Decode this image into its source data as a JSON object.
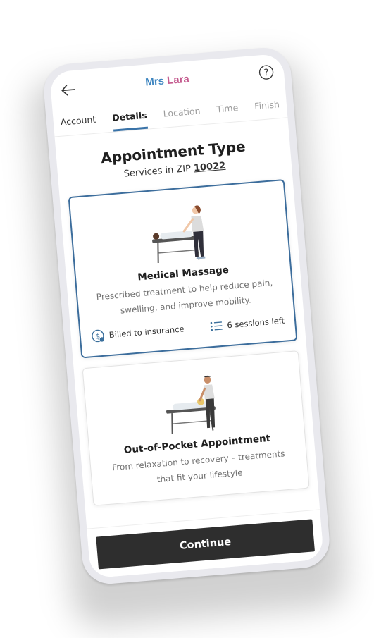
{
  "header": {
    "brand_first": "Mrs",
    "brand_second": "Lara",
    "back_icon": "arrow-left-icon",
    "help_icon": "question-circle-icon"
  },
  "tabs": [
    {
      "label": "Account",
      "state": "done"
    },
    {
      "label": "Details",
      "state": "active"
    },
    {
      "label": "Location",
      "state": "upcoming"
    },
    {
      "label": "Time",
      "state": "upcoming"
    },
    {
      "label": "Finish",
      "state": "upcoming"
    }
  ],
  "main": {
    "title": "Appointment Type",
    "subtitle_prefix": "Services in ZIP",
    "zip": "10022"
  },
  "cards": [
    {
      "title": "Medical Massage",
      "description": "Prescribed treatment to help reduce pain, swelling, and improve mobility.",
      "billing": "Billed to insurance",
      "sessions": "6 sessions left",
      "selected": true
    },
    {
      "title": "Out-of-Pocket Appointment",
      "description": "From relaxation to recovery – treatments that fit your lifestyle",
      "selected": false
    }
  ],
  "footer": {
    "continue_label": "Continue"
  },
  "colors": {
    "brand_blue": "#3f86c0",
    "brand_pink": "#c45a8e",
    "accent": "#3a73a8",
    "button_bg": "#2e2e2e"
  }
}
